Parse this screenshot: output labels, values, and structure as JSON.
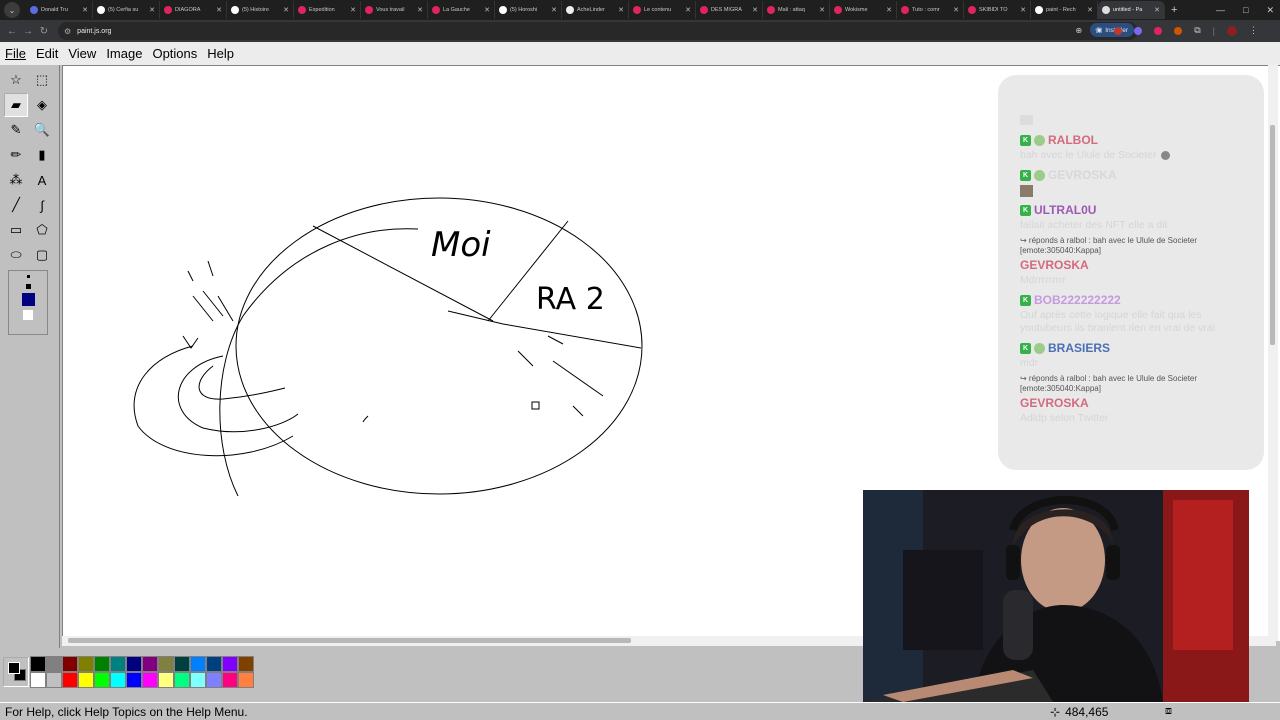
{
  "browser": {
    "tabs": [
      {
        "label": "Donald Tru",
        "fav": "#5b6ee1"
      },
      {
        "label": "(5) Cerfia su",
        "fav": "#ffffff"
      },
      {
        "label": "DIAGORA",
        "fav": "#e0245e"
      },
      {
        "label": "(5) Histoire",
        "fav": "#ffffff"
      },
      {
        "label": "Expedition",
        "fav": "#e0245e"
      },
      {
        "label": "Vous travail",
        "fav": "#e0245e"
      },
      {
        "label": "La Gauche",
        "fav": "#e0245e"
      },
      {
        "label": "(5) Horoshi",
        "fav": "#ffffff"
      },
      {
        "label": "AcheLinder",
        "fav": "#eeeeee"
      },
      {
        "label": "Le contenu",
        "fav": "#e0245e"
      },
      {
        "label": "DES MIGRA",
        "fav": "#e0245e"
      },
      {
        "label": "Mali : attaq",
        "fav": "#e0245e"
      },
      {
        "label": "Wokisme",
        "fav": "#e0245e"
      },
      {
        "label": "Tuto : comr",
        "fav": "#e0245e"
      },
      {
        "label": "SKIBIDI TO",
        "fav": "#e0245e"
      },
      {
        "label": "paint - Rech",
        "fav": "#ffffff"
      },
      {
        "label": "untitled - Pa",
        "fav": "#dddddd",
        "active": true
      }
    ],
    "new_tab": "+",
    "url": "paint.js.org",
    "install_label": "Installer"
  },
  "menu": {
    "file": "File",
    "edit": "Edit",
    "view": "View",
    "image": "Image",
    "options": "Options",
    "help": "Help"
  },
  "tools": [
    {
      "name": "free-form-select-tool",
      "glyph": "☆"
    },
    {
      "name": "rectangle-select-tool",
      "glyph": "⬚"
    },
    {
      "name": "eraser-tool",
      "glyph": "▰",
      "selected": true
    },
    {
      "name": "fill-bucket-tool",
      "glyph": "◈"
    },
    {
      "name": "color-picker-tool",
      "glyph": "✎"
    },
    {
      "name": "magnifier-tool",
      "glyph": "🔍"
    },
    {
      "name": "pencil-tool",
      "glyph": "✏"
    },
    {
      "name": "brush-tool",
      "glyph": "▮"
    },
    {
      "name": "airbrush-tool",
      "glyph": "⁂"
    },
    {
      "name": "text-tool",
      "glyph": "A"
    },
    {
      "name": "line-tool",
      "glyph": "╱"
    },
    {
      "name": "curve-tool",
      "glyph": "∫"
    },
    {
      "name": "rectangle-tool",
      "glyph": "▭"
    },
    {
      "name": "polygon-tool",
      "glyph": "⬠"
    },
    {
      "name": "ellipse-tool",
      "glyph": "⬭"
    },
    {
      "name": "rounded-rectangle-tool",
      "glyph": "▢"
    }
  ],
  "palette": {
    "colors": [
      "#000000",
      "#808080",
      "#800000",
      "#808000",
      "#008000",
      "#008080",
      "#000080",
      "#800080",
      "#808040",
      "#004040",
      "#0080ff",
      "#004080",
      "#8000ff",
      "#804000",
      "#ffffff",
      "#c0c0c0",
      "#ff0000",
      "#ffff00",
      "#00ff00",
      "#00ffff",
      "#0000ff",
      "#ff00ff",
      "#ffff80",
      "#00ff80",
      "#80ffff",
      "#8080ff",
      "#ff0080",
      "#ff8040"
    ]
  },
  "canvas": {
    "label_moi": "Moi",
    "label_ra2": "RA 2"
  },
  "status": {
    "help_text": "For Help, click Help Topics on the Help Menu.",
    "coords": "484,465"
  },
  "chat": {
    "messages": [
      {
        "user": "RALBOL",
        "color": "#d46a7e",
        "text": "bah avec le Ulule de Societer",
        "emote": true
      },
      {
        "user": "GEVROSKA",
        "color": "#d8d8d8",
        "text": "",
        "avatar": true
      },
      {
        "user": "ULTRAL0U",
        "color": "#9b59b6",
        "text": "fallait acheter des NFT elle a dit"
      },
      {
        "reply": "↪ réponds à ralbol : bah avec le Ulule de Societer [emote:305040:Kappa]",
        "user": "GEVROSKA",
        "color": "#d46a7e",
        "text": "Mdrrrrrrrrr"
      },
      {
        "user": "BOB222222222",
        "color": "#c39be0",
        "text": "Ouf après cette logique elle fait qua les youtubeurs ils branlent rien en vrai de vrai"
      },
      {
        "user": "BRASIERS",
        "color": "#4a6fb5",
        "text": "mdr"
      },
      {
        "reply": "↪ réponds à ralbol : bah avec le Ulule de Societer [emote:305040:Kappa]",
        "user": "GEVROSKA",
        "color": "#d46a7e",
        "text": "Adldp selon Twitter"
      }
    ]
  }
}
